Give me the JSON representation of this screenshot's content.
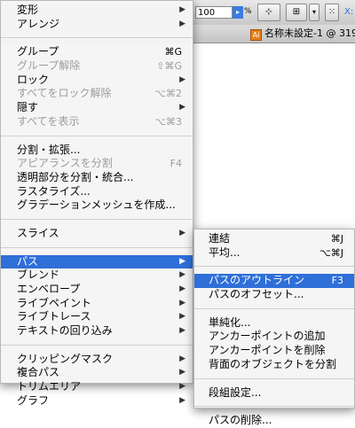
{
  "toolbar": {
    "zoom_value": "100",
    "zoom_unit": "%",
    "button_x_label": "X:"
  },
  "document": {
    "tab_title": "名称未設定-1 @ 319"
  },
  "main_menu": {
    "group1": [
      {
        "label": "変形",
        "submenu": true
      },
      {
        "label": "アレンジ",
        "submenu": true
      }
    ],
    "group2": [
      {
        "label": "グループ",
        "shortcut": "⌘G"
      },
      {
        "label": "グループ解除",
        "shortcut": "⇧⌘G",
        "disabled": true
      },
      {
        "label": "ロック",
        "submenu": true
      },
      {
        "label": "すべてをロック解除",
        "shortcut": "⌥⌘2",
        "disabled": true
      },
      {
        "label": "隠す",
        "submenu": true
      },
      {
        "label": "すべてを表示",
        "shortcut": "⌥⌘3",
        "disabled": true
      }
    ],
    "group3": [
      {
        "label": "分割・拡張..."
      },
      {
        "label": "アピアランスを分割",
        "shortcut": "F4",
        "disabled": true
      },
      {
        "label": "透明部分を分割・統合..."
      },
      {
        "label": "ラスタライズ..."
      },
      {
        "label": "グラデーションメッシュを作成..."
      }
    ],
    "group4": [
      {
        "label": "スライス",
        "submenu": true
      }
    ],
    "group5": [
      {
        "label": "パス",
        "submenu": true,
        "selected": true
      },
      {
        "label": "ブレンド",
        "submenu": true
      },
      {
        "label": "エンベロープ",
        "submenu": true
      },
      {
        "label": "ライブペイント",
        "submenu": true
      },
      {
        "label": "ライブトレース",
        "submenu": true
      },
      {
        "label": "テキストの回り込み",
        "submenu": true
      }
    ],
    "group6": [
      {
        "label": "クリッピングマスク",
        "submenu": true
      },
      {
        "label": "複合パス",
        "submenu": true
      },
      {
        "label": "トリムエリア",
        "submenu": true
      },
      {
        "label": "グラフ",
        "submenu": true
      }
    ]
  },
  "sub_menu": {
    "group1": [
      {
        "label": "連結",
        "shortcut": "⌘J"
      },
      {
        "label": "平均...",
        "shortcut": "⌥⌘J"
      }
    ],
    "group2": [
      {
        "label": "パスのアウトライン",
        "shortcut": "F3",
        "selected": true
      },
      {
        "label": "パスのオフセット..."
      }
    ],
    "group3": [
      {
        "label": "単純化..."
      },
      {
        "label": "アンカーポイントの追加"
      },
      {
        "label": "アンカーポイントを削除"
      },
      {
        "label": "背面のオブジェクトを分割"
      }
    ],
    "group4": [
      {
        "label": "段組設定..."
      }
    ],
    "group5": [
      {
        "label": "パスの削除..."
      }
    ]
  },
  "colors": {
    "selection": "#2f6fd8",
    "disabled_text": "#9c9c9c",
    "doc_icon": "#e87f1a"
  }
}
